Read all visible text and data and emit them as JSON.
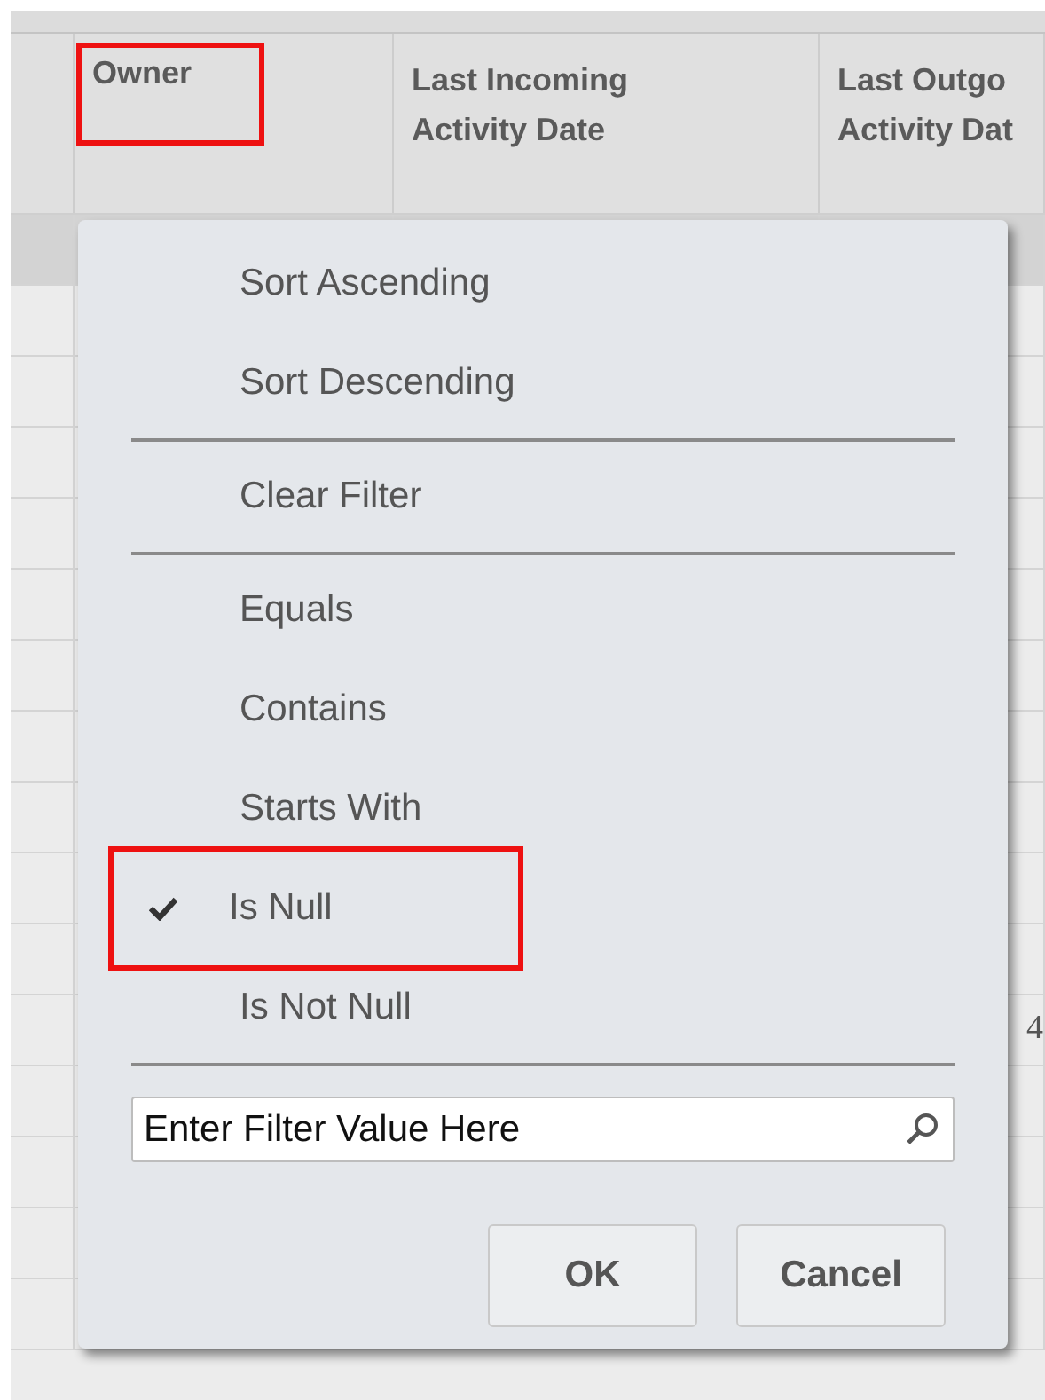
{
  "table": {
    "columns": [
      {
        "label": "Owner",
        "highlighted": true
      },
      {
        "label": "Last Incoming Activity Date",
        "highlighted": false
      },
      {
        "label": "Last Outgo Activity Dat",
        "highlighted": false
      }
    ],
    "visible_cell": "4"
  },
  "menu": {
    "items": [
      {
        "kind": "option",
        "label": "Sort Ascending",
        "checked": false,
        "highlighted": false
      },
      {
        "kind": "option",
        "label": "Sort Descending",
        "checked": false,
        "highlighted": false
      },
      {
        "kind": "divider"
      },
      {
        "kind": "option",
        "label": "Clear Filter",
        "checked": false,
        "highlighted": false
      },
      {
        "kind": "divider"
      },
      {
        "kind": "option",
        "label": "Equals",
        "checked": false,
        "highlighted": false
      },
      {
        "kind": "option",
        "label": "Contains",
        "checked": false,
        "highlighted": false
      },
      {
        "kind": "option",
        "label": "Starts With",
        "checked": false,
        "highlighted": false
      },
      {
        "kind": "option",
        "label": "Is Null",
        "checked": true,
        "highlighted": true
      },
      {
        "kind": "option",
        "label": "Is Not Null",
        "checked": false,
        "highlighted": false
      },
      {
        "kind": "divider"
      }
    ],
    "filter_field": {
      "value": "Enter Filter Value Here"
    },
    "buttons": [
      "OK",
      "Cancel"
    ]
  }
}
